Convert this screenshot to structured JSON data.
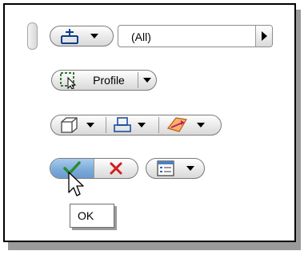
{
  "toolbar": {
    "grip_icon": "toolbar-grip",
    "filter_icon": "selection-filter-icon",
    "filter_value": "(All)",
    "profile_icon": "profile-select-icon",
    "profile_label": "Profile",
    "view_icon": "cube-view-icon",
    "plane_icon": "plane-icon",
    "direction_icon": "direction-arrow-icon",
    "ok_icon": "checkmark-icon",
    "cancel_icon": "cancel-x-icon",
    "options_icon": "options-menu-icon"
  },
  "tooltip": {
    "text": "OK"
  },
  "colors": {
    "accent_selected": "#79a9d8",
    "ok_green": "#2e8a2e",
    "cancel_red": "#d41b1b",
    "profile_green": "#3f9b3f",
    "direction_orange": "#e38a2a"
  }
}
